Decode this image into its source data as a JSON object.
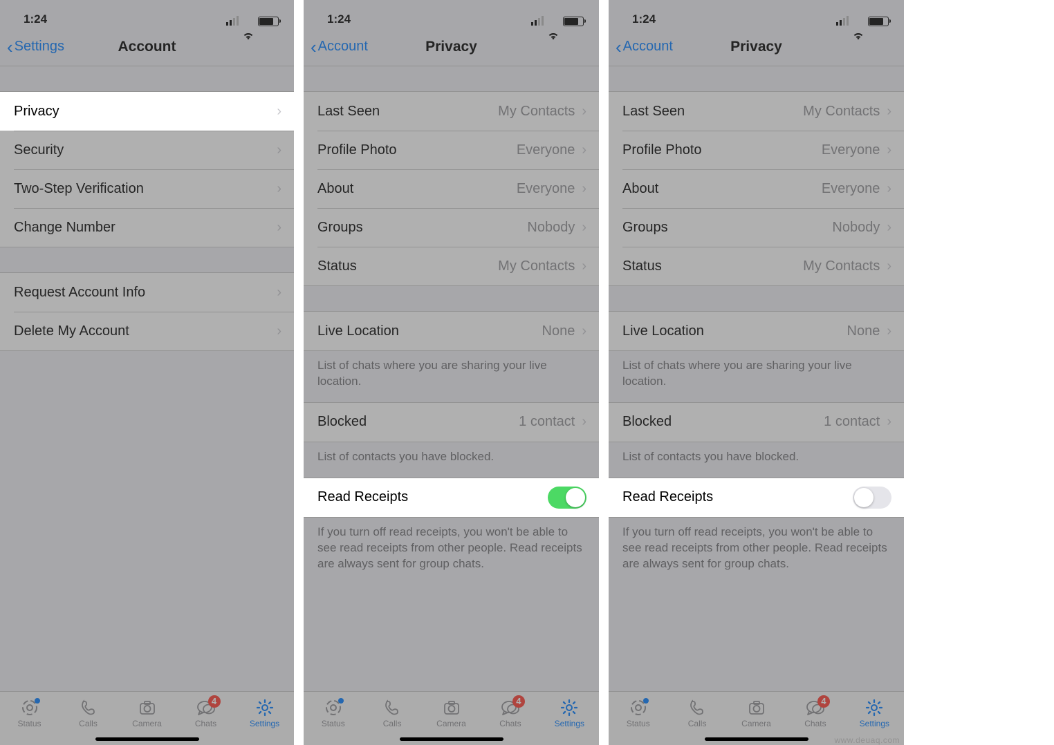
{
  "status": {
    "time": "1:24"
  },
  "watermark": "www.deuaq.com",
  "screens": [
    {
      "nav": {
        "back": "Settings",
        "title": "Account"
      },
      "account_items": [
        {
          "label": "Privacy",
          "highlight": true
        },
        {
          "label": "Security"
        },
        {
          "label": "Two-Step Verification"
        },
        {
          "label": "Change Number"
        }
      ],
      "account_items2": [
        {
          "label": "Request Account Info"
        },
        {
          "label": "Delete My Account"
        }
      ]
    },
    {
      "nav": {
        "back": "Account",
        "title": "Privacy"
      },
      "privacy": {
        "items": [
          {
            "label": "Last Seen",
            "value": "My Contacts"
          },
          {
            "label": "Profile Photo",
            "value": "Everyone"
          },
          {
            "label": "About",
            "value": "Everyone"
          },
          {
            "label": "Groups",
            "value": "Nobody"
          },
          {
            "label": "Status",
            "value": "My Contacts"
          }
        ],
        "live": {
          "label": "Live Location",
          "value": "None",
          "footer": "List of chats where you are sharing your live location."
        },
        "blocked": {
          "label": "Blocked",
          "value": "1 contact",
          "footer": "List of contacts you have blocked."
        },
        "read": {
          "label": "Read Receipts",
          "on": true,
          "footer": "If you turn off read receipts, you won't be able to see read receipts from other people. Read receipts are always sent for group chats."
        }
      }
    },
    {
      "nav": {
        "back": "Account",
        "title": "Privacy"
      },
      "privacy": {
        "items": [
          {
            "label": "Last Seen",
            "value": "My Contacts"
          },
          {
            "label": "Profile Photo",
            "value": "Everyone"
          },
          {
            "label": "About",
            "value": "Everyone"
          },
          {
            "label": "Groups",
            "value": "Nobody"
          },
          {
            "label": "Status",
            "value": "My Contacts"
          }
        ],
        "live": {
          "label": "Live Location",
          "value": "None",
          "footer": "List of chats where you are sharing your live location."
        },
        "blocked": {
          "label": "Blocked",
          "value": "1 contact",
          "footer": "List of contacts you have blocked."
        },
        "read": {
          "label": "Read Receipts",
          "on": false,
          "footer": "If you turn off read receipts, you won't be able to see read receipts from other people. Read receipts are always sent for group chats."
        }
      }
    }
  ],
  "tabs": [
    {
      "label": "Status"
    },
    {
      "label": "Calls"
    },
    {
      "label": "Camera"
    },
    {
      "label": "Chats",
      "badge": "4"
    },
    {
      "label": "Settings",
      "active": true
    }
  ]
}
